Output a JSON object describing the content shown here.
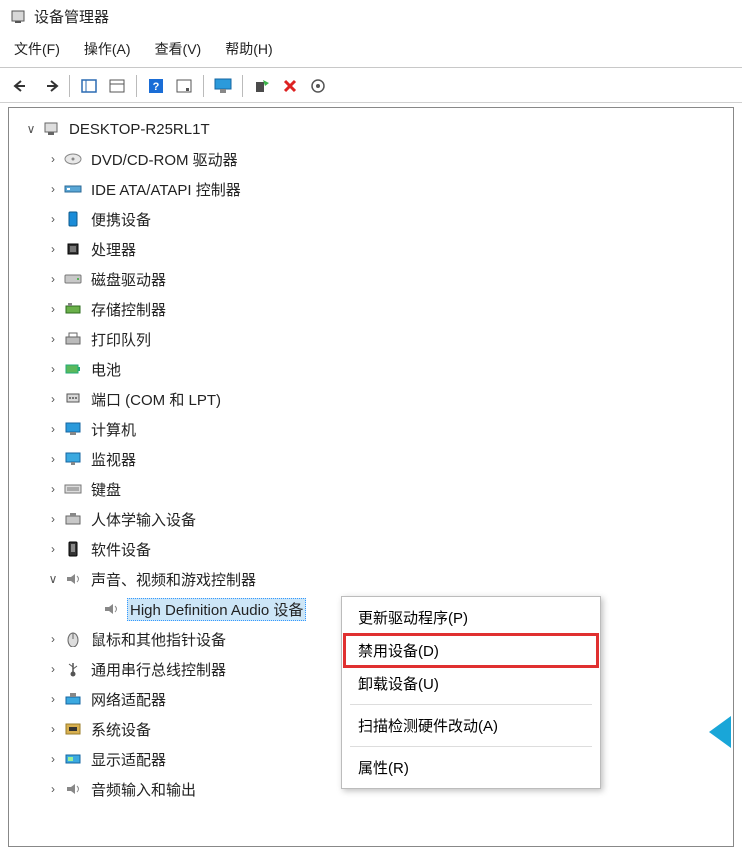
{
  "window": {
    "title": "设备管理器"
  },
  "menu": {
    "file": "文件(F)",
    "action": "操作(A)",
    "view": "查看(V)",
    "help": "帮助(H)"
  },
  "toolbar_icons": {
    "back": "back-arrow-icon",
    "forward": "forward-arrow-icon",
    "show_hide": "show-hide-console-icon",
    "view_mode": "view-mode-icon",
    "help_q": "help-icon",
    "properties": "properties-icon",
    "monitor": "monitor-icon",
    "enable": "enable-device-icon",
    "delete": "delete-icon",
    "scan": "scan-hardware-icon"
  },
  "tree": {
    "root": {
      "label": "DESKTOP-R25RL1T",
      "expanded": true
    },
    "nodes": [
      {
        "label": "DVD/CD-ROM 驱动器",
        "icon": "disc-drive-icon",
        "expanded": false
      },
      {
        "label": "IDE ATA/ATAPI 控制器",
        "icon": "controller-icon",
        "expanded": false
      },
      {
        "label": "便携设备",
        "icon": "portable-device-icon",
        "expanded": false
      },
      {
        "label": "处理器",
        "icon": "processor-icon",
        "expanded": false
      },
      {
        "label": "磁盘驱动器",
        "icon": "disk-drive-icon",
        "expanded": false
      },
      {
        "label": "存储控制器",
        "icon": "storage-controller-icon",
        "expanded": false
      },
      {
        "label": "打印队列",
        "icon": "print-queue-icon",
        "expanded": false
      },
      {
        "label": "电池",
        "icon": "battery-icon",
        "expanded": false
      },
      {
        "label": "端口 (COM 和 LPT)",
        "icon": "ports-icon",
        "expanded": false
      },
      {
        "label": "计算机",
        "icon": "computer-icon",
        "expanded": false
      },
      {
        "label": "监视器",
        "icon": "monitor-icon",
        "expanded": false
      },
      {
        "label": "键盘",
        "icon": "keyboard-icon",
        "expanded": false
      },
      {
        "label": "人体学输入设备",
        "icon": "hid-icon",
        "expanded": false
      },
      {
        "label": "软件设备",
        "icon": "software-device-icon",
        "expanded": false
      },
      {
        "label": "声音、视频和游戏控制器",
        "icon": "sound-icon",
        "expanded": true,
        "children": [
          {
            "label": "High Definition Audio 设备",
            "icon": "speaker-icon",
            "selected": true
          }
        ]
      },
      {
        "label": "鼠标和其他指针设备",
        "icon": "mouse-icon",
        "expanded": false
      },
      {
        "label": "通用串行总线控制器",
        "icon": "usb-icon",
        "expanded": false
      },
      {
        "label": "网络适配器",
        "icon": "network-adapter-icon",
        "expanded": false
      },
      {
        "label": "系统设备",
        "icon": "system-device-icon",
        "expanded": false
      },
      {
        "label": "显示适配器",
        "icon": "display-adapter-icon",
        "expanded": false
      },
      {
        "label": "音频输入和输出",
        "icon": "audio-io-icon",
        "expanded": false
      }
    ]
  },
  "context_menu": {
    "items": [
      {
        "label": "更新驱动程序(P)",
        "key": "update-driver"
      },
      {
        "label": "禁用设备(D)",
        "key": "disable-device",
        "highlighted": true
      },
      {
        "label": "卸载设备(U)",
        "key": "uninstall-device"
      },
      {
        "separator": true
      },
      {
        "label": "扫描检测硬件改动(A)",
        "key": "scan-hardware"
      },
      {
        "separator": true
      },
      {
        "label": "属性(R)",
        "key": "properties"
      }
    ]
  }
}
